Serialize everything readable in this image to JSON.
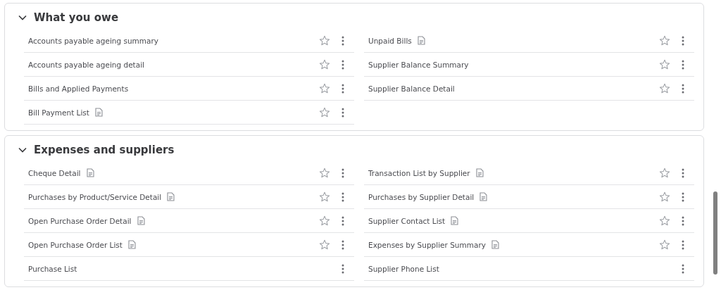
{
  "sections": [
    {
      "title": "What you owe",
      "expanded": true,
      "columns": [
        [
          {
            "label": "Accounts payable ageing summary",
            "report_icon": false,
            "star": true
          },
          {
            "label": "Accounts payable ageing detail",
            "report_icon": false,
            "star": true
          },
          {
            "label": "Bills and Applied Payments",
            "report_icon": false,
            "star": true
          },
          {
            "label": "Bill Payment List",
            "report_icon": true,
            "star": true
          }
        ],
        [
          {
            "label": "Unpaid Bills",
            "report_icon": true,
            "star": true
          },
          {
            "label": "Supplier Balance Summary",
            "report_icon": false,
            "star": true
          },
          {
            "label": "Supplier Balance Detail",
            "report_icon": false,
            "star": true
          }
        ]
      ]
    },
    {
      "title": "Expenses and suppliers",
      "expanded": true,
      "columns": [
        [
          {
            "label": "Cheque Detail",
            "report_icon": true,
            "star": true
          },
          {
            "label": "Purchases by Product/Service Detail",
            "report_icon": true,
            "star": true
          },
          {
            "label": "Open Purchase Order Detail",
            "report_icon": true,
            "star": true
          },
          {
            "label": "Open Purchase Order List",
            "report_icon": true,
            "star": true
          },
          {
            "label": "Purchase List",
            "report_icon": false,
            "star": false
          }
        ],
        [
          {
            "label": "Transaction List by Supplier",
            "report_icon": true,
            "star": true
          },
          {
            "label": "Purchases by Supplier Detail",
            "report_icon": true,
            "star": true
          },
          {
            "label": "Supplier Contact List",
            "report_icon": true,
            "star": true
          },
          {
            "label": "Expenses by Supplier Summary",
            "report_icon": true,
            "star": true
          },
          {
            "label": "Supplier Phone List",
            "report_icon": false,
            "star": false
          }
        ]
      ]
    }
  ]
}
